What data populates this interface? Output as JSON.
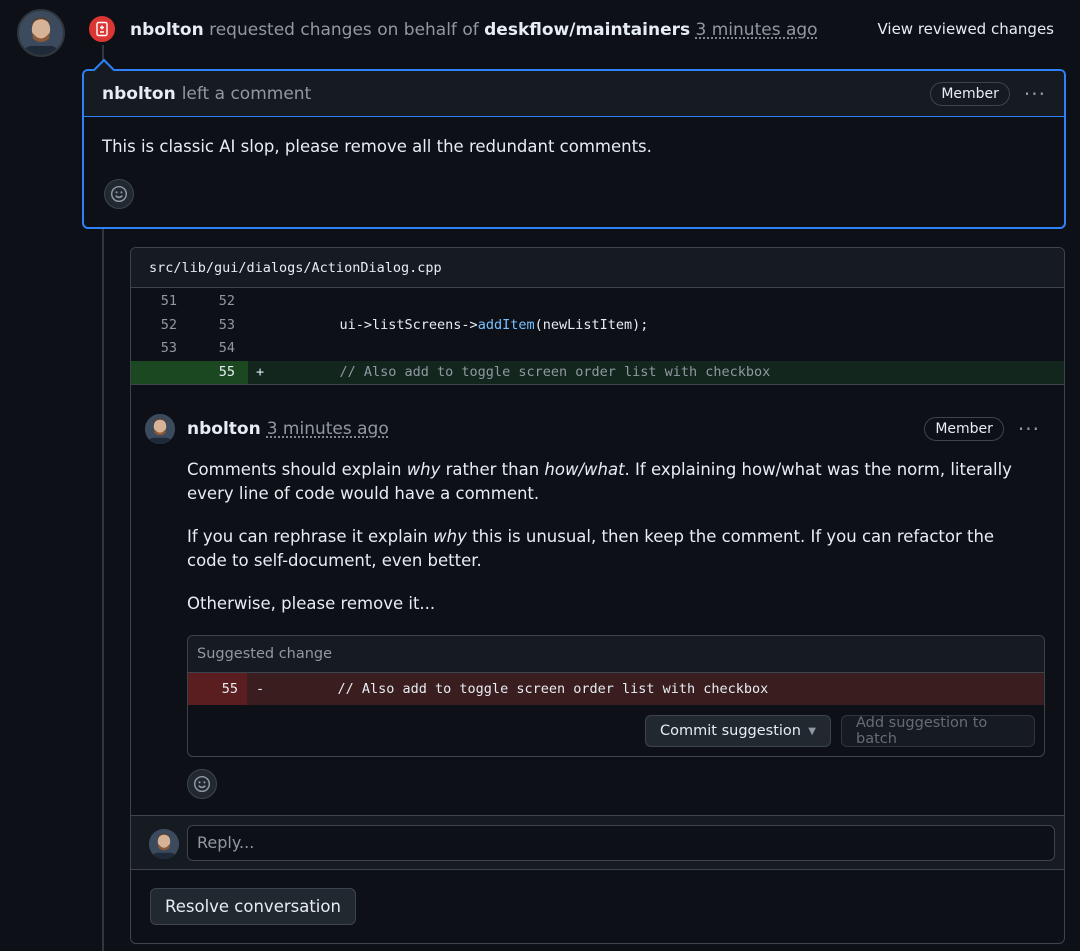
{
  "event": {
    "author": "nbolton",
    "action": "requested changes on behalf of",
    "team": "deskflow/maintainers",
    "timestamp": "3 minutes ago",
    "view_changes_label": "View reviewed changes",
    "status_color": "#da3633"
  },
  "review": {
    "author": "nbolton",
    "action": "left a comment",
    "badge": "Member",
    "body": "This is classic AI slop, please remove all the redundant comments."
  },
  "thread": {
    "file_path": "src/lib/gui/dialogs/ActionDialog.cpp",
    "diff_lines": [
      {
        "old": "51",
        "new": "52",
        "sign": "",
        "code": ""
      },
      {
        "old": "52",
        "new": "53",
        "sign": "",
        "code_prefix": "    ui->listScreens->",
        "code_fn": "addItem",
        "code_suffix": "(newListItem);"
      },
      {
        "old": "53",
        "new": "54",
        "sign": "",
        "code": ""
      },
      {
        "old": "",
        "new": "55",
        "sign": "+",
        "code": "    // Also add to toggle screen order list with checkbox"
      }
    ],
    "comment": {
      "author": "nbolton",
      "timestamp": "3 minutes ago",
      "badge": "Member",
      "p1_a": "Comments should explain ",
      "p1_em1": "why",
      "p1_b": " rather than ",
      "p1_em2": "how/what",
      "p1_c": ". If explaining how/what was the norm, literally every line of code would have a comment.",
      "p2_a": "If you can rephrase it explain ",
      "p2_em": "why",
      "p2_b": " this is unusual, then keep the comment. If you can refactor the code to self-document, even better.",
      "p3": "Otherwise, please remove it...",
      "suggestion": {
        "header": "Suggested change",
        "line": "55",
        "sign": "-",
        "code": "    // Also add to toggle screen order list with checkbox",
        "commit_label": "Commit suggestion",
        "batch_label": "Add suggestion to batch"
      }
    },
    "reply_placeholder": "Reply...",
    "resolve_label": "Resolve conversation"
  },
  "icons": {
    "event": "file-diff-icon",
    "menu": "kebab-horizontal-icon",
    "reaction": "smiley-icon",
    "dropdown": "triangle-down-icon"
  },
  "colors": {
    "accent": "#2f81f7",
    "added_bg": "#12261e",
    "deleted_bg": "#3a1d1f",
    "function_name": "#79c0ff"
  }
}
